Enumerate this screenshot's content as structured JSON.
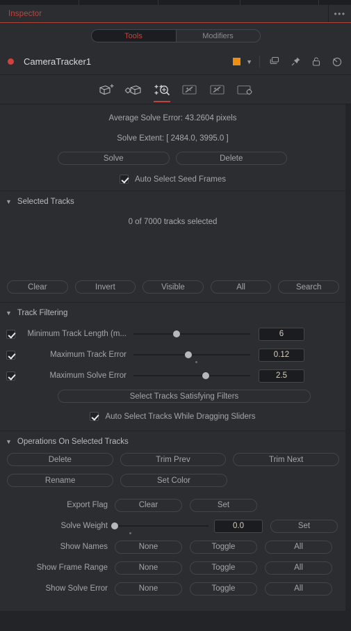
{
  "panel": {
    "tab_label": "Inspector",
    "menu_icon": "overflow-menu-icon",
    "accent_color": "#c0443c"
  },
  "mode_tabs": [
    {
      "label": "Tools",
      "active": true
    },
    {
      "label": "Modifiers",
      "active": false
    }
  ],
  "node": {
    "name": "CameraTracker1",
    "status_dot_color": "#d4403a",
    "color_swatch": "#ef8f11",
    "chevron_icon": "chevron-down-icon",
    "tool_icons": [
      "copy-icon",
      "pin-icon",
      "lock-icon",
      "reset-icon"
    ]
  },
  "icon_tabs": [
    {
      "name": "camera-add-icon",
      "active": false
    },
    {
      "name": "camera-settings-icon",
      "active": false
    },
    {
      "name": "track-magnify-icon",
      "active": true
    },
    {
      "name": "wand-sparkle-icon",
      "active": false
    },
    {
      "name": "wand-sparkle-alt-icon",
      "active": false
    },
    {
      "name": "panel-settings-icon",
      "active": false
    }
  ],
  "solve": {
    "average_solve_error": "Average Solve Error:  43.2604 pixels",
    "solve_extent": "Solve Extent:  [ 2484.0, 3995.0 ]",
    "solve_button": "Solve",
    "delete_button": "Delete",
    "auto_seed_label": "Auto Select Seed Frames",
    "auto_seed_checked": true
  },
  "selected_tracks": {
    "title": "Selected Tracks",
    "status": "0 of 7000 tracks selected",
    "buttons": [
      "Clear",
      "Invert",
      "Visible",
      "All",
      "Search"
    ]
  },
  "track_filtering": {
    "title": "Track Filtering",
    "rows": [
      {
        "label": "Minimum Track Length (m...",
        "value": "6",
        "checked": true,
        "knob_pct": 37,
        "dot_pct": null
      },
      {
        "label": "Maximum Track Error",
        "value": "0.12",
        "checked": true,
        "knob_pct": 47,
        "dot_pct": 54
      },
      {
        "label": "Maximum Solve Error",
        "value": "2.5",
        "checked": true,
        "knob_pct": 62,
        "dot_pct": null
      }
    ],
    "select_button": "Select Tracks Satisfying Filters",
    "auto_select_label": "Auto Select Tracks While Dragging Sliders",
    "auto_select_checked": true
  },
  "operations": {
    "title": "Operations On Selected Tracks",
    "row1": [
      "Delete",
      "Trim Prev",
      "Trim Next"
    ],
    "row2": [
      "Rename",
      "Set Color"
    ],
    "export_flag": {
      "label": "Export Flag",
      "buttons": [
        "Clear",
        "Set"
      ]
    },
    "solve_weight": {
      "label": "Solve Weight",
      "value": "0.0",
      "knob_pct": 0,
      "dot_pct": 17,
      "set_button": "Set"
    },
    "toggles": [
      {
        "label": "Show Names",
        "buttons": [
          "None",
          "Toggle",
          "All"
        ]
      },
      {
        "label": "Show Frame Range",
        "buttons": [
          "None",
          "Toggle",
          "All"
        ]
      },
      {
        "label": "Show Solve Error",
        "buttons": [
          "None",
          "Toggle",
          "All"
        ]
      }
    ]
  }
}
